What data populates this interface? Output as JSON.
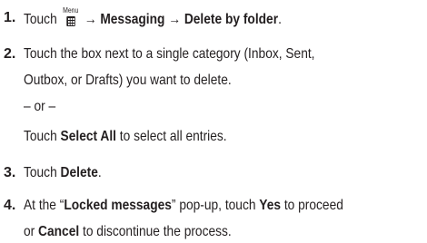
{
  "steps": [
    {
      "number": "1.",
      "text_before_icon": "Touch ",
      "icon": "menu-key-icon",
      "icon_label": "Menu",
      "text_after_icon": " → Messaging → Delete by folder",
      "trailing": "."
    },
    {
      "number": "2.",
      "line1": "Touch the box next to a single category (Inbox, Sent,",
      "line2": "Outbox, or Drafts) you want to delete.",
      "or": "– or –",
      "alt_before": "Touch ",
      "alt_bold": "Select All",
      "alt_after": " to select all entries."
    },
    {
      "number": "3.",
      "text_before": "Touch ",
      "bold": "Delete",
      "trailing": "."
    },
    {
      "number": "4.",
      "p1": "At the “",
      "b1": "Locked messages",
      "p2": "” pop-up, touch ",
      "b2": "Yes",
      "p3": " to proceed",
      "p4": "or ",
      "b3": "Cancel",
      "p5": " to discontinue the process."
    }
  ]
}
